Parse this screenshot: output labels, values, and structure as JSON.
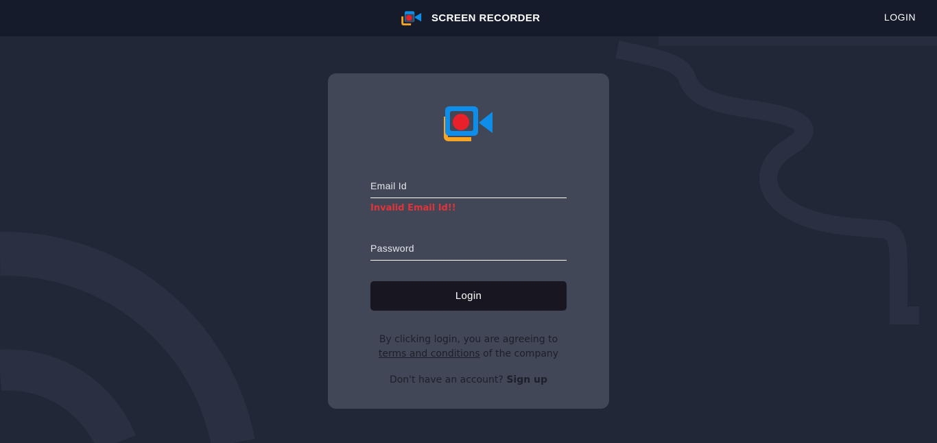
{
  "header": {
    "brand_name": "SCREEN RECORDER",
    "login_link": "LOGIN"
  },
  "login_form": {
    "email": {
      "placeholder": "Email Id",
      "value": ""
    },
    "email_error": "Invalid Email Id!!",
    "password": {
      "placeholder": "Password",
      "value": ""
    },
    "submit_label": "Login",
    "terms_prefix": "By clicking login, you are agreeing to",
    "terms_link": "terms and conditions",
    "terms_suffix": " of the company",
    "signup_prompt": "Don't have an account? ",
    "signup_link": "Sign up"
  },
  "icons": {
    "logo": "video-camera-record-icon"
  },
  "colors": {
    "background": "#212736",
    "topbar": "#151b2b",
    "card": "#414756",
    "error": "#e0343a",
    "button": "#181621",
    "logo_blue": "#0e8ee8",
    "logo_orange": "#f6a623",
    "logo_red": "#e8202a"
  }
}
